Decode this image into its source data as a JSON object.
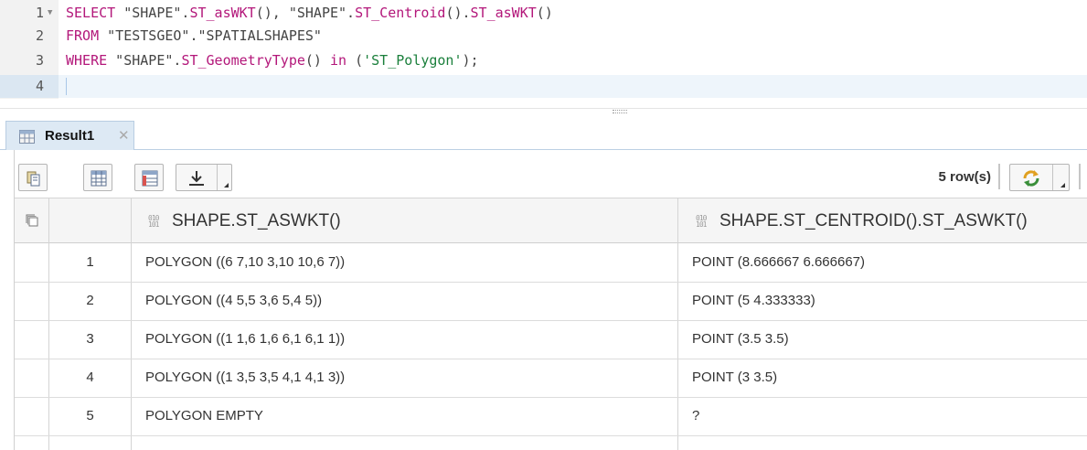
{
  "editor": {
    "lines": [
      {
        "num": "1"
      },
      {
        "num": "2"
      },
      {
        "num": "3"
      },
      {
        "num": "4"
      }
    ],
    "tokens": {
      "l1_kw": "SELECT",
      "l1_a": " \"SHAPE\".",
      "l1_fn1": "ST_asWKT",
      "l1_b": "(), \"SHAPE\".",
      "l1_fn2": "ST_Centroid",
      "l1_c": "().",
      "l1_fn3": "ST_asWKT",
      "l1_d": "()",
      "l2_kw": "FROM",
      "l2_a": " \"TESTSGEO\".\"SPATIALSHAPES\"",
      "l3_kw": "WHERE",
      "l3_a": " \"SHAPE\".",
      "l3_fn": "ST_GeometryType",
      "l3_b": "() ",
      "l3_kw2": "in",
      "l3_c": " (",
      "l3_str": "'ST_Polygon'",
      "l3_d": ");"
    }
  },
  "tab": {
    "label": "Result1",
    "close": "✕"
  },
  "toolbar": {
    "row_count": "5 row(s)"
  },
  "grid": {
    "columns": [
      "SHAPE.ST_ASWKT()",
      "SHAPE.ST_CENTROID().ST_ASWKT()"
    ],
    "rows": [
      {
        "num": "1",
        "c1": "POLYGON ((6 7,10 3,10 10,6 7))",
        "c2": "POINT (8.666667 6.666667)"
      },
      {
        "num": "2",
        "c1": "POLYGON ((4 5,5 3,6 5,4 5))",
        "c2": "POINT (5 4.333333)"
      },
      {
        "num": "3",
        "c1": "POLYGON ((1 1,6 1,6 6,1 6,1 1))",
        "c2": "POINT (3.5 3.5)"
      },
      {
        "num": "4",
        "c1": "POLYGON ((1 3,5 3,5 4,1 4,1 3))",
        "c2": "POINT (3 3.5)"
      },
      {
        "num": "5",
        "c1": "POLYGON EMPTY",
        "c2": "?"
      }
    ]
  },
  "colors": {
    "keyword": "#b3177a",
    "string_literal": "#1a7f3b",
    "tab_bg": "#dde9f4"
  }
}
